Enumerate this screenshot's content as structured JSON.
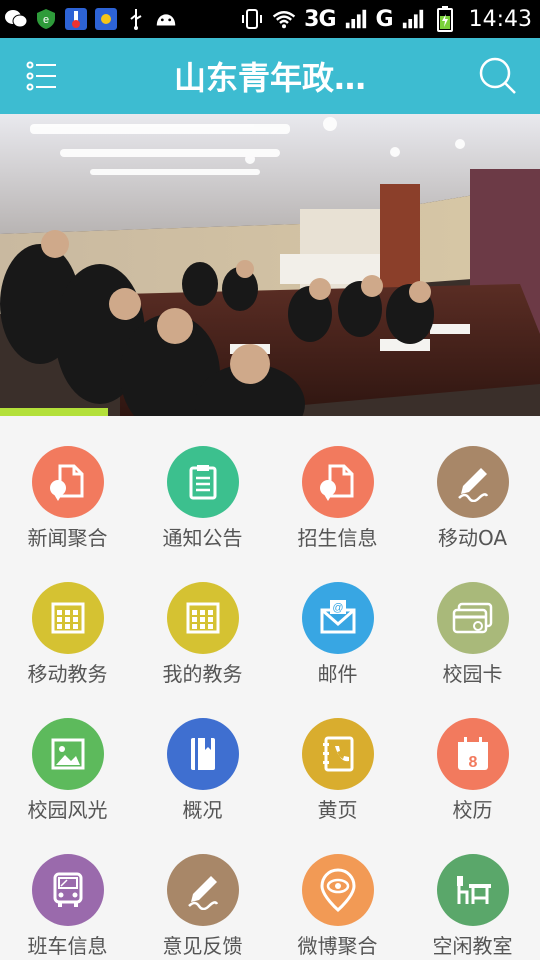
{
  "status_bar": {
    "network_1": "3G",
    "network_2": "G",
    "time": "14:43"
  },
  "header": {
    "title": "山东青年政…",
    "accent_color": "#3dbcd1"
  },
  "banner": {
    "description_icon": "meeting-photo",
    "slide_progress": 0.2
  },
  "grid": [
    {
      "label": "新闻聚合",
      "icon": "map-pin-doc-icon",
      "color": "#f27a5e"
    },
    {
      "label": "通知公告",
      "icon": "clipboard-icon",
      "color": "#3cc08e"
    },
    {
      "label": "招生信息",
      "icon": "map-pin-doc-icon",
      "color": "#f27a5e"
    },
    {
      "label": "移动OA",
      "icon": "sign-pen-icon",
      "color": "#a88768"
    },
    {
      "label": "移动教务",
      "icon": "calendar-grid-icon",
      "color": "#d5c232"
    },
    {
      "label": "我的教务",
      "icon": "calendar-grid-icon",
      "color": "#d5c232"
    },
    {
      "label": "邮件",
      "icon": "mail-icon",
      "color": "#38a6e3"
    },
    {
      "label": "校园卡",
      "icon": "card-icon",
      "color": "#a9b97a"
    },
    {
      "label": "校园风光",
      "icon": "picture-icon",
      "color": "#5dba5c"
    },
    {
      "label": "概况",
      "icon": "book-icon",
      "color": "#3f6fd0"
    },
    {
      "label": "黄页",
      "icon": "phonebook-icon",
      "color": "#d9ad2e"
    },
    {
      "label": "校历",
      "icon": "calendar-icon",
      "color": "#f27a5e"
    },
    {
      "label": "班车信息",
      "icon": "bus-icon",
      "color": "#9a6aac"
    },
    {
      "label": "意见反馈",
      "icon": "sign-pen-icon",
      "color": "#a88768"
    },
    {
      "label": "微博聚合",
      "icon": "eye-pin-icon",
      "color": "#f29a55"
    },
    {
      "label": "空闲教室",
      "icon": "desk-icon",
      "color": "#5aa76a"
    }
  ]
}
